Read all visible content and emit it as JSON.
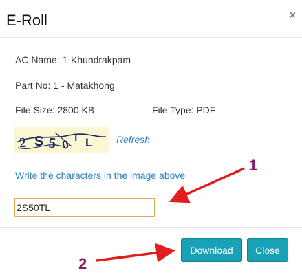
{
  "modal": {
    "title": "E-Roll",
    "close_symbol": "×"
  },
  "info": {
    "ac_name": "AC Name: 1-Khundrakpam",
    "part_no": "Part No: 1 - Matakhong",
    "file_size": "File Size: 2800 KB",
    "file_type": "File Type: PDF"
  },
  "captcha": {
    "image_text": "2S50TL",
    "refresh_label": "Refresh",
    "instruction": "Write the characters in the image above",
    "input_value": "2S50TL"
  },
  "footer": {
    "download_label": "Download",
    "close_label": "Close"
  },
  "annotations": {
    "marker_1": "1",
    "marker_2": "2",
    "arrow_color": "#e11d1d",
    "marker_color": "#8b1c6a"
  },
  "colors": {
    "button_bg": "#17a2b8",
    "link": "#2a82c6",
    "input_border": "#e2a74f",
    "captcha_bg": "#fbf7d4"
  }
}
